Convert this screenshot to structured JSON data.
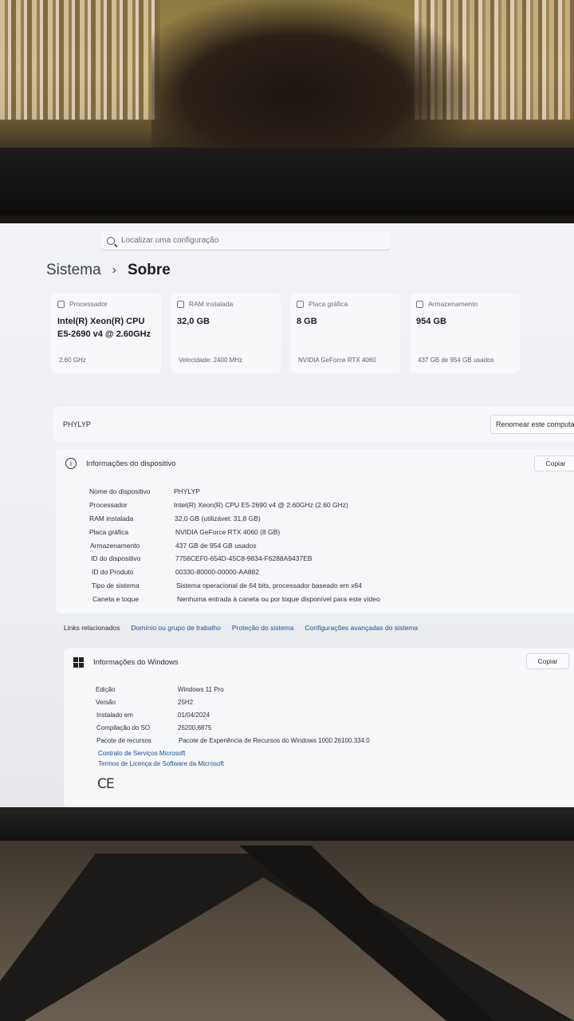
{
  "search": {
    "placeholder": "Localizar uma configuração"
  },
  "breadcrumb": {
    "parent": "Sistema",
    "separator": "›",
    "current": "Sobre"
  },
  "cards": [
    {
      "label": "Processador",
      "value": "Intel(R) Xeon(R) CPU E5-2690 v4 @ 2.60GHz",
      "sub": "2.60 GHz"
    },
    {
      "label": "RAM instalada",
      "value": "32,0 GB",
      "sub": "Velocidade: 2400 MHz"
    },
    {
      "label": "Placa gráfica",
      "value": "8 GB",
      "sub": "NVIDIA GeForce RTX 4060"
    },
    {
      "label": "Armazenamento",
      "value": "954 GB",
      "sub": "437 GB de 954 GB usados"
    }
  ],
  "device": {
    "name": "PHYLYP",
    "rename_label": "Renomear este computador"
  },
  "device_info": {
    "title": "Informações do dispositivo",
    "copy_label": "Copiar",
    "rows": [
      {
        "key": "Nome do dispositivo",
        "value": "PHYLYP"
      },
      {
        "key": "Processador",
        "value": "Intel(R) Xeon(R) CPU E5-2690 v4 @ 2.60GHz (2.60 GHz)"
      },
      {
        "key": "RAM instalada",
        "value": "32,0 GB (utilizável: 31,8 GB)"
      },
      {
        "key": "Placa gráfica",
        "value": "NVIDIA GeForce RTX 4060 (8 GB)"
      },
      {
        "key": "Armazenamento",
        "value": "437 GB de 954 GB usados"
      },
      {
        "key": "ID do dispositivo",
        "value": "7756CEF0-654D-45C8-9834-F6288A9437EB"
      },
      {
        "key": "ID do Produto",
        "value": "00330-80000-00000-AA882"
      },
      {
        "key": "Tipo de sistema",
        "value": "Sistema operacional de 64 bits, processador baseado em x64"
      },
      {
        "key": "Caneta e toque",
        "value": "Nenhuma entrada à caneta ou por toque disponível para este vídeo"
      }
    ]
  },
  "related": {
    "label": "Links relacionados",
    "links": [
      "Domínio ou grupo de trabalho",
      "Proteção do sistema",
      "Configurações avançadas do sistema"
    ]
  },
  "windows_info": {
    "title": "Informações do Windows",
    "copy_label": "Copiar",
    "rows": [
      {
        "key": "Edição",
        "value": "Windows 11 Pro"
      },
      {
        "key": "Versão",
        "value": "25H2"
      },
      {
        "key": "Instalado em",
        "value": "01/04/2024"
      },
      {
        "key": "Compilação do SO",
        "value": "26200.6875"
      },
      {
        "key": "Pacote de recursos",
        "value": "Pacote de Experiência de Recursos do Windows 1000.26100.334.0"
      }
    ],
    "links": [
      "Contrato de Serviços Microsoft",
      "Termos de Licença de Software da Microsoft"
    ],
    "mark": "CE"
  }
}
